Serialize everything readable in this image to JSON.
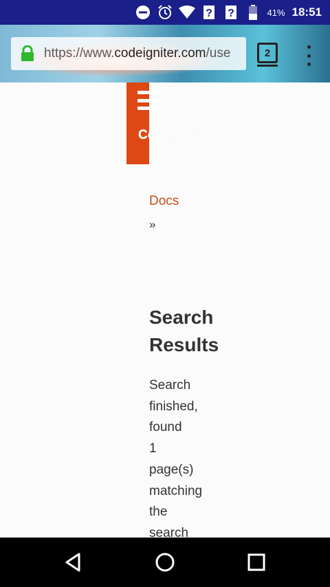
{
  "status_bar": {
    "battery_percent": "41%",
    "time": "18:51",
    "icons": [
      "do-not-disturb-icon",
      "alarm-icon",
      "wifi-icon",
      "no-signal-icon",
      "no-signal-icon",
      "battery-icon"
    ]
  },
  "browser": {
    "url_scheme": "https://www.",
    "url_host": "codeigniter.com",
    "url_path": "/use",
    "tab_count": "2"
  },
  "page": {
    "brand": "CodeIgniter",
    "breadcrumb": {
      "docs": "Docs",
      "separator": "»"
    },
    "title": "Search Results",
    "message": "Search finished, found 1 page(s) matching the search",
    "accent_color": "#dd4814"
  },
  "navbar": {
    "icons": [
      "back-icon",
      "home-icon",
      "recents-icon"
    ]
  }
}
